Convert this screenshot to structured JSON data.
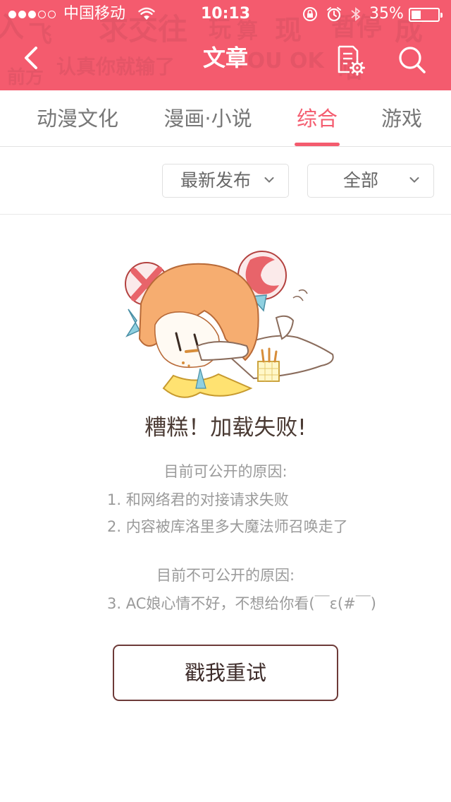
{
  "status_bar": {
    "carrier": "中国移动",
    "time": "10:13",
    "battery": "35%",
    "battery_level": 0.35,
    "signal_bars_filled": 3,
    "signal_bars_total": 5
  },
  "header": {
    "title": "文章",
    "background_color": "#f45b6e",
    "back_icon": "chevron-left-icon",
    "doc_settings_icon": "document-gear-icon",
    "search_icon": "search-icon"
  },
  "tabs": [
    {
      "label": "动漫文化",
      "active": false
    },
    {
      "label": "漫画·小说",
      "active": false
    },
    {
      "label": "综合",
      "active": true
    },
    {
      "label": "游戏",
      "active": false
    }
  ],
  "filters": {
    "sort": {
      "value": "最新发布"
    },
    "category": {
      "value": "全部"
    }
  },
  "error": {
    "title": "糟糕！加载失败!",
    "public_heading": "目前可公开的原因:",
    "public_reasons": [
      "1. 和网络君的对接请求失败",
      "2. 内容被库洛里多大魔法师召唤走了"
    ],
    "private_heading": "目前不可公开的原因:",
    "private_reasons": [
      "3. AC娘心情不好，不想给你看(￣ε(#￣)"
    ],
    "retry_label": "戳我重试"
  },
  "colors": {
    "accent": "#f45b6e",
    "tab_inactive": "#777777",
    "muted_text": "#9a9a9a",
    "button_border": "#6d3a38"
  }
}
